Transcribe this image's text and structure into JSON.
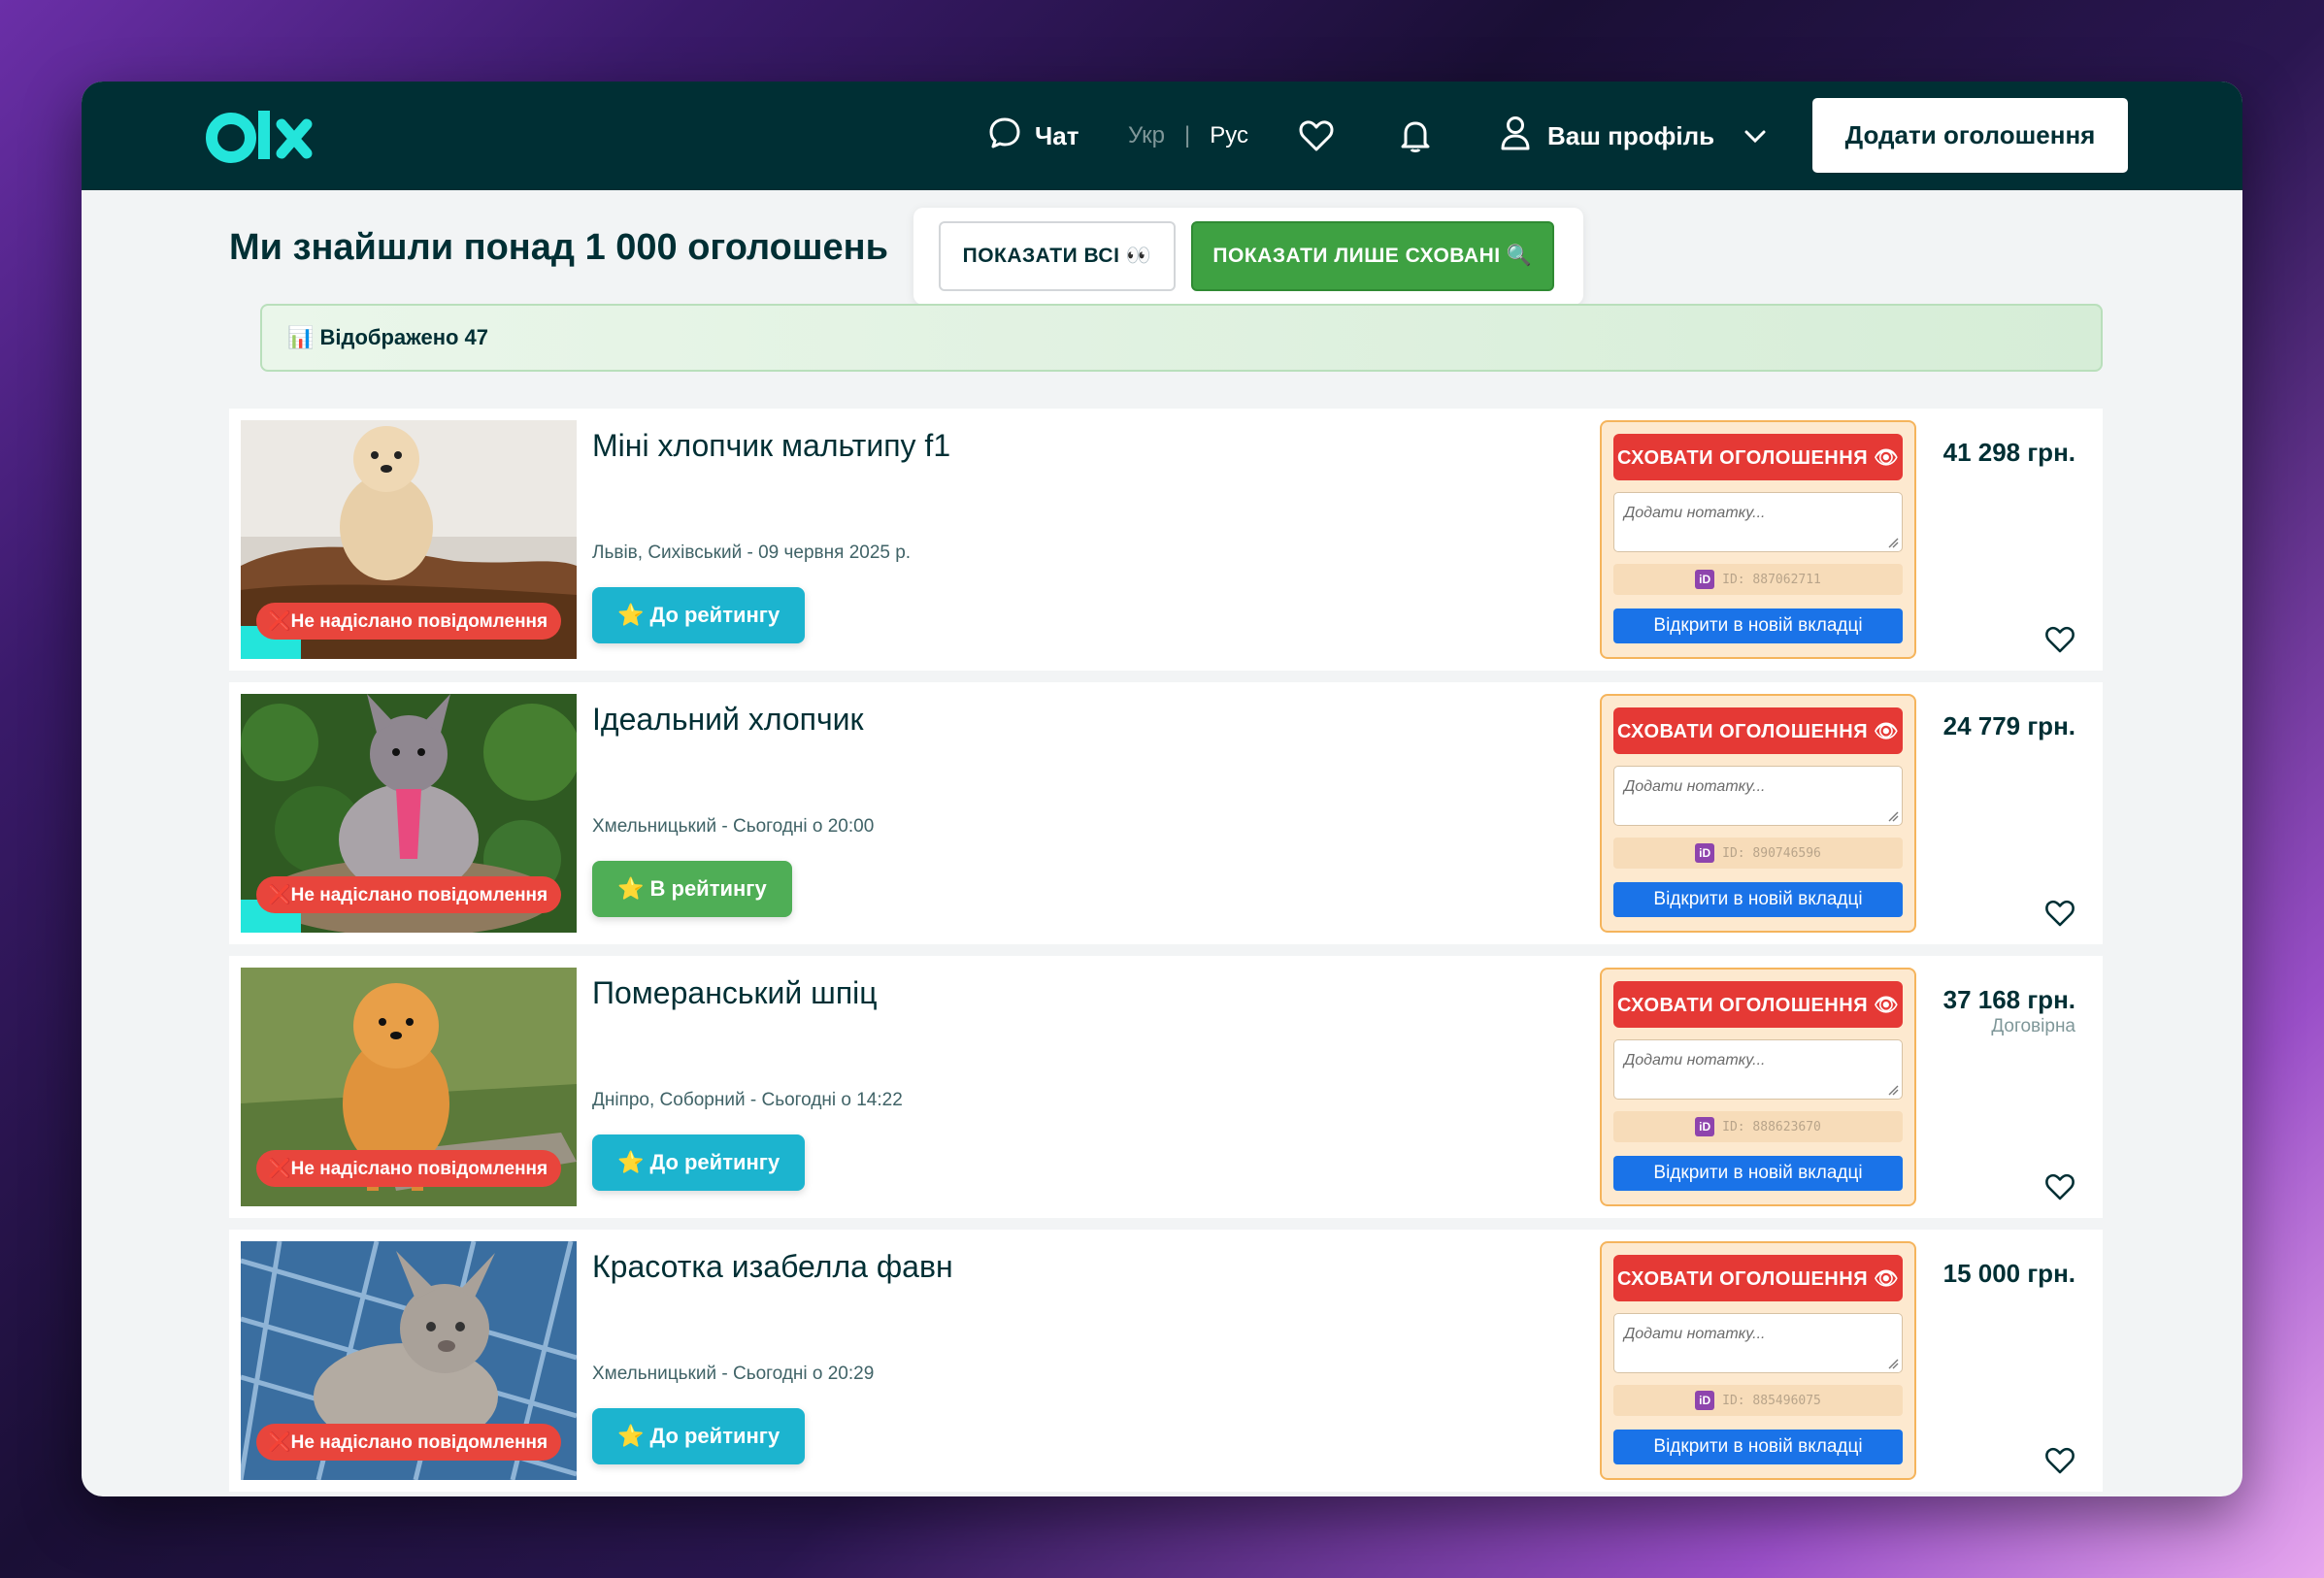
{
  "header": {
    "chat_label": "Чат",
    "lang_ukr": "Укр",
    "lang_sep": "|",
    "lang_rus": "Рус",
    "profile_label": "Ваш профіль",
    "add_button": "Додати оголошення"
  },
  "results": {
    "title": "Ми знайшли понад 1 000 оголошень",
    "show_all": "ПОКАЗАТИ ВСІ 👀",
    "show_hidden": "ПОКАЗАТИ ЛИШЕ СХОВАНІ 🔍",
    "stats": "📊 Відображено 47"
  },
  "listings": [
    {
      "title": "Міні хлопчик мальтипу f1",
      "location": "Львів, Сихівський - 09 червня 2025 р.",
      "no_msg": "❌Не надіслано повідомлення",
      "rate_label": "⭐ До рейтингу",
      "hide_label": "СХОВАТИ ОГОЛОШЕННЯ 👁",
      "note_placeholder": "Додати нотатку...",
      "id_text": "ID: 887062711",
      "open_label": "Відкрити в новій вкладці",
      "price": "41 298 грн.",
      "negotiable": ""
    },
    {
      "title": "Ідеальний хлопчик",
      "location": "Хмельницький - Сьогодні о 20:00",
      "no_msg": "❌Не надіслано повідомлення",
      "rate_label": "⭐ В рейтингу",
      "hide_label": "СХОВАТИ ОГОЛОШЕННЯ 👁",
      "note_placeholder": "Додати нотатку...",
      "id_text": "ID: 890746596",
      "open_label": "Відкрити в новій вкладці",
      "price": "24 779 грн.",
      "negotiable": ""
    },
    {
      "title": "Померанський шпіц",
      "location": "Дніпро, Соборний - Сьогодні о 14:22",
      "no_msg": "❌Не надіслано повідомлення",
      "rate_label": "⭐ До рейтингу",
      "hide_label": "СХОВАТИ ОГОЛОШЕННЯ 👁",
      "note_placeholder": "Додати нотатку...",
      "id_text": "ID: 888623670",
      "open_label": "Відкрити в новій вкладці",
      "price": "37 168 грн.",
      "negotiable": "Договірна"
    },
    {
      "title": "Красотка изабелла фавн",
      "location": "Хмельницький - Сьогодні о 20:29",
      "no_msg": "❌Не надіслано повідомлення",
      "rate_label": "⭐ До рейтингу",
      "hide_label": "СХОВАТИ ОГОЛОШЕННЯ 👁",
      "note_placeholder": "Додати нотатку...",
      "id_text": "ID: 885496075",
      "open_label": "Відкрити в новій вкладці",
      "price": "15 000 грн.",
      "negotiable": ""
    }
  ],
  "icons": {
    "logo": "olx-logo",
    "chat": "chat-bubble-icon",
    "favorites": "heart-icon",
    "notifications": "bell-icon",
    "profile": "user-icon",
    "dropdown": "chevron-down-icon",
    "id": "id-badge-icon"
  },
  "colors": {
    "brand_dark": "#002f34",
    "brand_teal": "#23e5db",
    "hide_red": "#e53935",
    "show_hidden_green": "#3ea142",
    "open_blue": "#1a73e8"
  }
}
